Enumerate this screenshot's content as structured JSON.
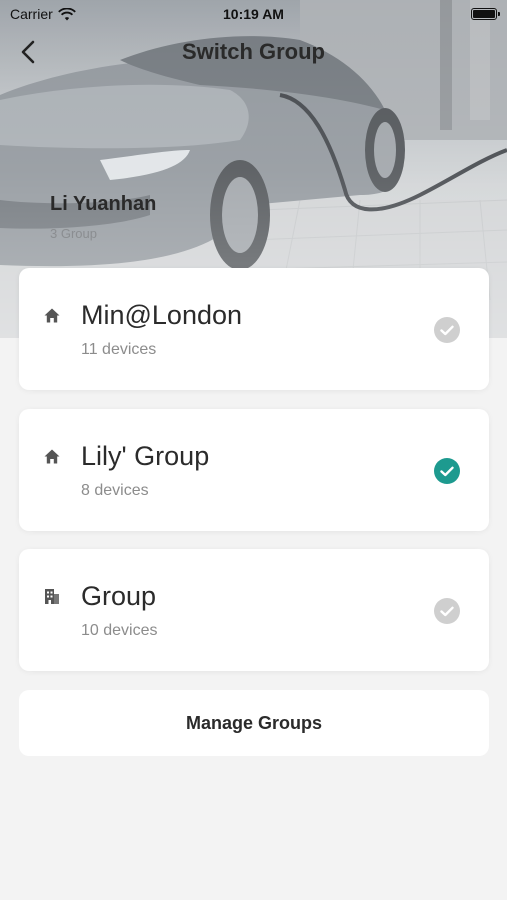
{
  "status_bar": {
    "carrier": "Carrier",
    "time": "10:19 AM"
  },
  "nav": {
    "title": "Switch Group",
    "back_icon": "chevron-left-icon"
  },
  "user": {
    "name": "Li Yuanhan",
    "group_count": "3 Group"
  },
  "groups": [
    {
      "name": "Min@London",
      "devices": "11 devices",
      "icon": "home-icon",
      "selected": false
    },
    {
      "name": "Lily' Group",
      "devices": "8 devices",
      "icon": "home-icon",
      "selected": true
    },
    {
      "name": "Group",
      "devices": "10 devices",
      "icon": "building-icon",
      "selected": false
    }
  ],
  "manage_label": "Manage Groups",
  "colors": {
    "accent": "#1d9a8f",
    "check_off": "#cfcfcf",
    "background": "#f3f3f3"
  }
}
